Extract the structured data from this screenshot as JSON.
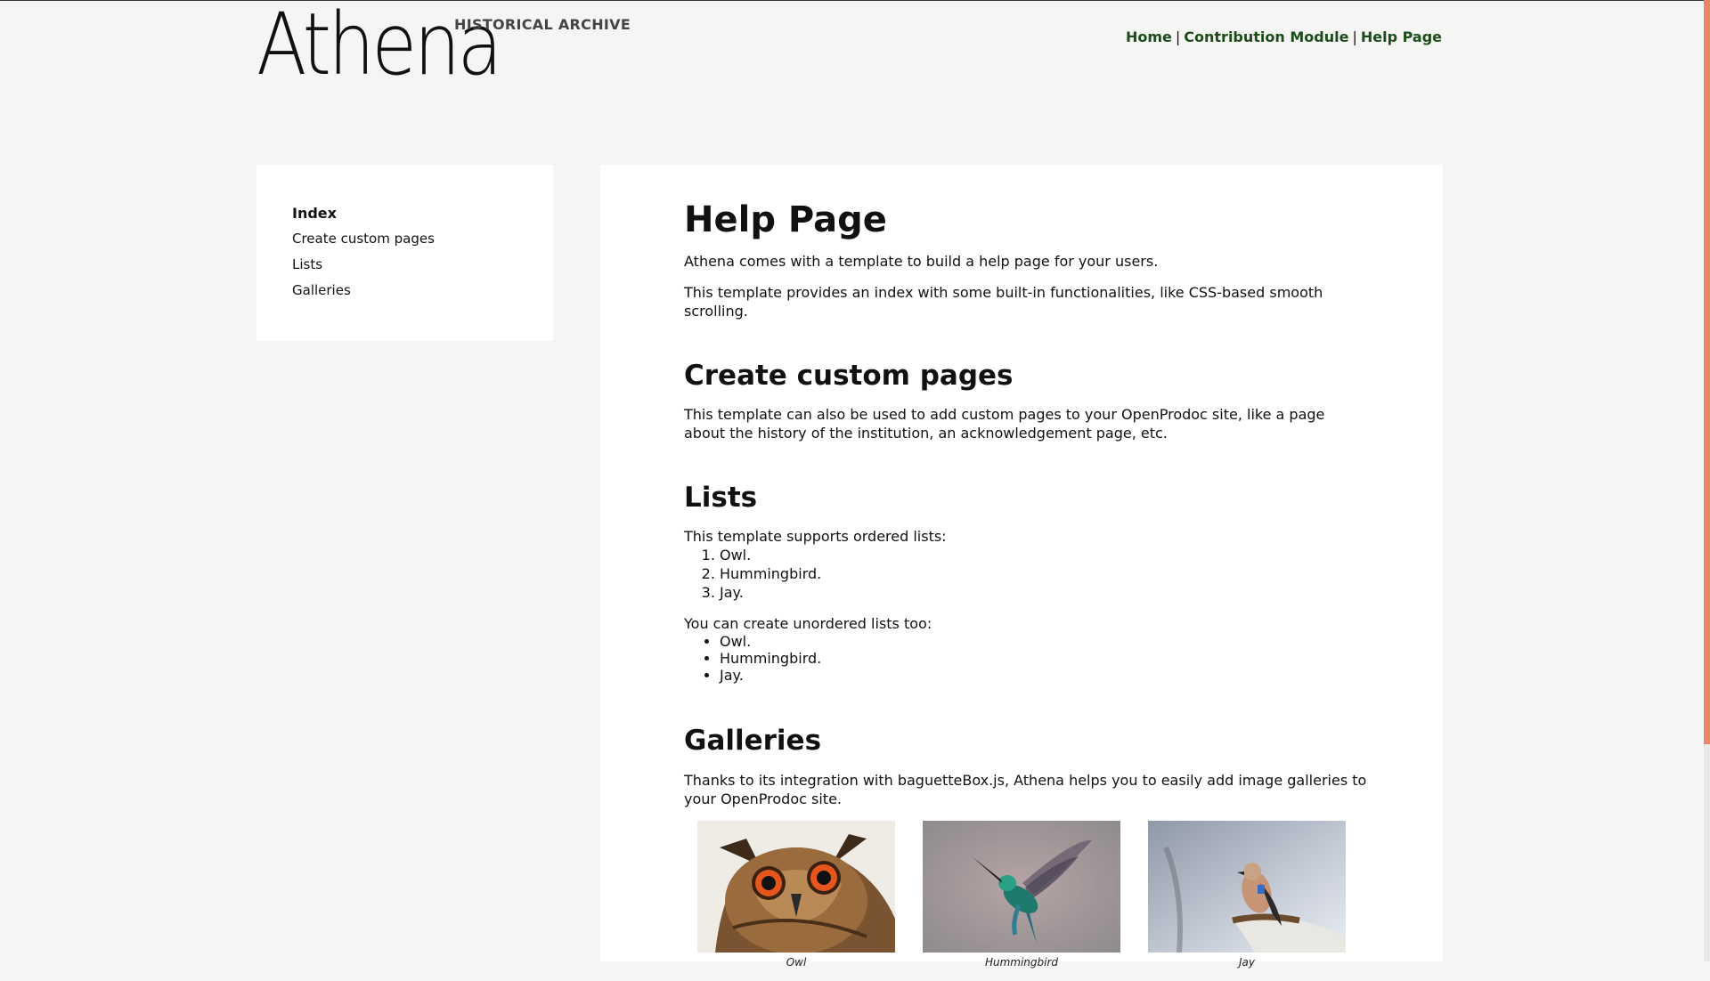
{
  "header": {
    "logo_text": "Athena",
    "subtitle": "HISTORICAL ARCHIVE",
    "nav": [
      {
        "label": "Home"
      },
      {
        "label": "Contribution Module"
      },
      {
        "label": "Help Page"
      }
    ],
    "nav_separator": "|"
  },
  "sidebar": {
    "heading": "Index",
    "items": [
      {
        "label": "Create custom pages"
      },
      {
        "label": "Lists"
      },
      {
        "label": "Galleries"
      }
    ]
  },
  "main": {
    "title": "Help Page",
    "intro": [
      "Athena comes with a template to build a help page for your users.",
      "This template provides an index with some built-in functionalities, like CSS-based smooth scrolling."
    ],
    "custom_pages": {
      "heading": "Create custom pages",
      "text": "This template can also be used to add custom pages to your OpenProdoc site, like a page about the history of the institution, an acknowledgement page, etc."
    },
    "lists": {
      "heading": "Lists",
      "ordered_intro": "This template supports ordered lists:",
      "ordered": [
        "Owl.",
        "Hummingbird.",
        "Jay."
      ],
      "unordered_intro": "You can create unordered lists too:",
      "unordered": [
        "Owl.",
        "Hummingbird.",
        "Jay."
      ]
    },
    "galleries": {
      "heading": "Galleries",
      "text": "Thanks to its integration with baguetteBox.js, Athena helps you to easily add image galleries to your OpenProdoc site.",
      "images": [
        {
          "caption": "Owl"
        },
        {
          "caption": "Hummingbird"
        },
        {
          "caption": "Jay"
        }
      ]
    }
  },
  "colors": {
    "background": "#f5f5f3",
    "panel": "#ffffff",
    "nav_link": "#1b4d1b",
    "scrollbar_thumb": "#e8876a"
  }
}
